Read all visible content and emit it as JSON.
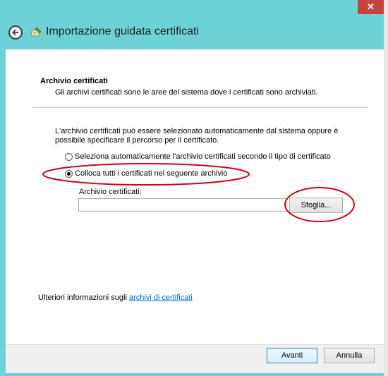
{
  "window": {
    "close_glyph": "✕",
    "title": "Importazione guidata certificati"
  },
  "header": {
    "section_title": "Archivio certificati",
    "section_desc": "Gli archivi certificati sono le aree del sistema dove i certificati sono archiviati."
  },
  "body": {
    "paragraph": "L'archivio certificati può essere selezionato automaticamente dal sistema oppure è possibile specificare il percorso per il certificato.",
    "radio_auto_label": "Seleziona automaticamente l'archivio certificati secondo il tipo di certificato",
    "radio_manual_label": "Colloca tutti i certificati nel seguente archivio",
    "selected_option": "manual",
    "store_field_label": "Archivio certificati:",
    "store_field_value": "",
    "browse_label": "Sfoglia..."
  },
  "info": {
    "prefix": "Ulteriori informazioni sugli ",
    "link": "archivi di certificati"
  },
  "footer": {
    "next_label": "Avanti",
    "cancel_label": "Annulla"
  },
  "colors": {
    "frame": "#6dd2d8",
    "close": "#c7443a",
    "annotation": "#d0021b",
    "link": "#0066cc"
  },
  "icons": [
    "back-arrow-icon",
    "certificate-wizard-icon",
    "close-icon"
  ]
}
